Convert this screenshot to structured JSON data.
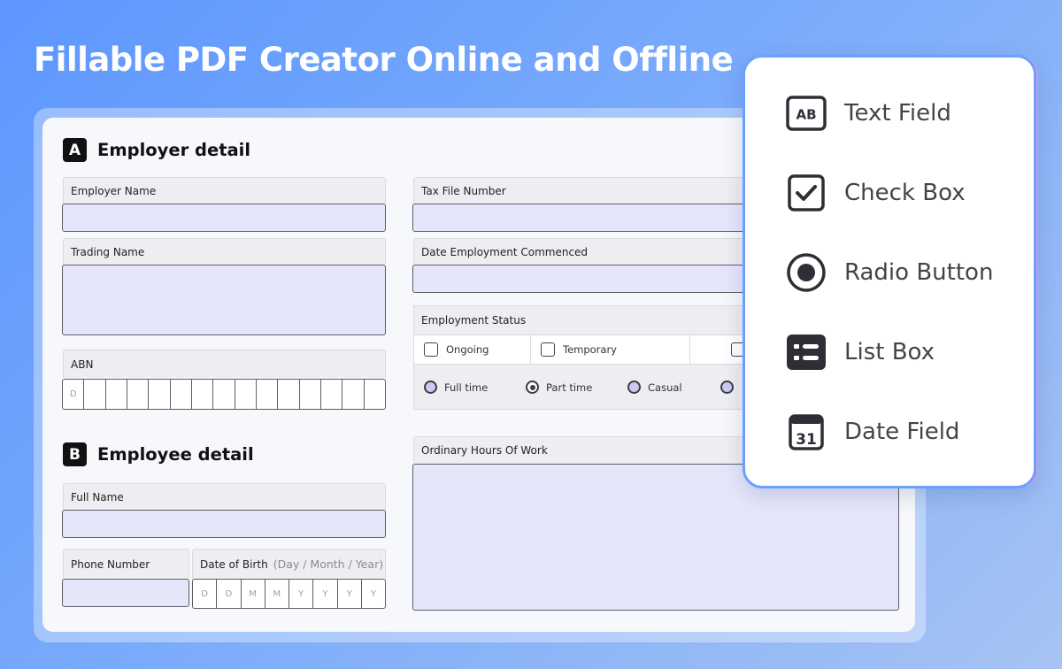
{
  "headline": "Fillable PDF Creator Online and Offline",
  "form": {
    "section_a": {
      "badge": "A",
      "title": "Employer detail"
    },
    "section_b": {
      "badge": "B",
      "title": "Employee detail"
    },
    "employer_name": {
      "label": "Employer Name"
    },
    "trading_name": {
      "label": "Trading Name"
    },
    "abn": {
      "label": "ABN",
      "first_cell": "D"
    },
    "tax_file_number": {
      "label": "Tax File Number"
    },
    "date_employment_commenced": {
      "label": "Date Employment Commenced"
    },
    "employment_status": {
      "label": "Employment Status",
      "checkboxes": [
        "Ongoing",
        "Temporary"
      ],
      "radios": [
        {
          "label": "Full time",
          "selected": false
        },
        {
          "label": "Part time",
          "selected": true
        },
        {
          "label": "Casual",
          "selected": false
        }
      ]
    },
    "ordinary_hours": {
      "label": "Ordinary Hours Of Work"
    },
    "full_name": {
      "label": "Full Name"
    },
    "phone_number": {
      "label": "Phone Number"
    },
    "date_of_birth": {
      "label": "Date of Birth",
      "hint": "(Day / Month / Year)",
      "cells": [
        "D",
        "D",
        "M",
        "M",
        "Y",
        "Y",
        "Y",
        "Y"
      ]
    }
  },
  "palette": {
    "items": [
      {
        "label": "Text Field",
        "icon": "text-field-icon",
        "glyph": "AB"
      },
      {
        "label": "Check Box",
        "icon": "checkbox-icon"
      },
      {
        "label": "Radio Button",
        "icon": "radio-button-icon"
      },
      {
        "label": "List Box",
        "icon": "list-box-icon"
      },
      {
        "label": "Date Field",
        "icon": "date-field-icon",
        "glyph": "31"
      }
    ]
  },
  "colors": {
    "background_start": "#5d97ff",
    "input_fill": "#e6e6fb",
    "palette_border": "#6aa0ff"
  }
}
